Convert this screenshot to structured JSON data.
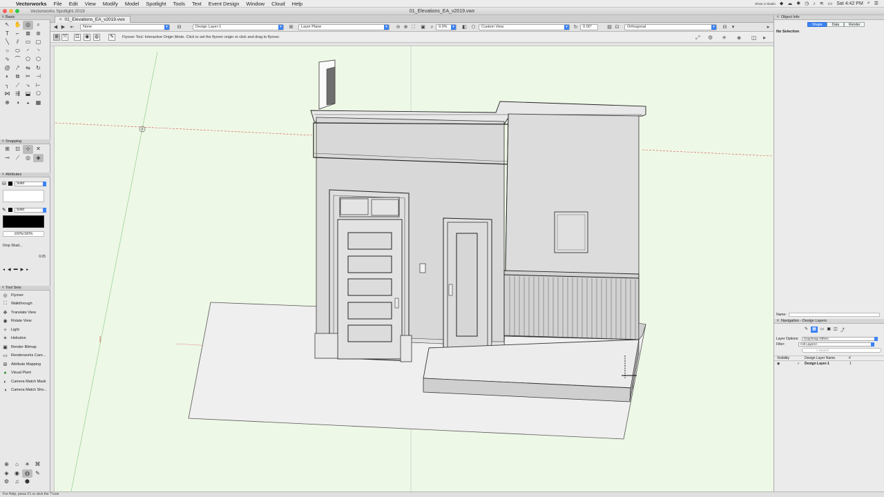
{
  "menubar": {
    "app_name": "Vectorworks",
    "items": [
      "File",
      "Edit",
      "View",
      "Modify",
      "Model",
      "Spotlight",
      "Tools",
      "Text",
      "Event Design",
      "Window",
      "Cloud",
      "Help"
    ],
    "clock": "Sat 4:42 PM",
    "indicator": "Show U Studio"
  },
  "window": {
    "app_title": "Vectorworks Spotlight 2019",
    "doc_title": "01_Elevations_EA_v2019.vwx",
    "tab_label": "01_Elevations_EA_v2019.vwx"
  },
  "viewbar": {
    "class_select": "None",
    "layer_select": "Design Layer-1",
    "plane_select": "Layer Plane",
    "zoom": "9.0%",
    "view_select": "Custom View",
    "rotation": "0.00°",
    "projection": "Orthogonal"
  },
  "modebar": {
    "help_text": "Flyover Tool: Interactive Origin Mode. Click to set the flyover origin or click and drag to flyover."
  },
  "palettes": {
    "basic_title": "Basic",
    "snapping_title": "Snapping",
    "attributes_title": "Attributes",
    "fill_style": "Solid",
    "pen_style": "Solid",
    "opacity": "100%/100%",
    "drop_shadow": "Drop Shad...",
    "line_weight": "0.05",
    "toolsets_title": "Tool Sets",
    "tool_sets": [
      {
        "icon": "flyover-icon",
        "label": "Flyover"
      },
      {
        "icon": "walkthrough-icon",
        "label": "Walkthrough"
      },
      {
        "icon": "translate-view-icon",
        "label": "Translate View"
      },
      {
        "icon": "rotate-view-icon",
        "label": "Rotate View"
      },
      {
        "icon": "light-icon",
        "label": "Light"
      },
      {
        "icon": "heliodon-icon",
        "label": "Heliodon"
      },
      {
        "icon": "renderer-bitmap-icon",
        "label": "Render Bitmap"
      },
      {
        "icon": "renderworks-camera-icon",
        "label": "Renderworks Cam..."
      },
      {
        "icon": "attribute-mapping-icon",
        "label": "Attribute Mapping"
      },
      {
        "icon": "visual-plant-icon",
        "label": "Visual Plant"
      },
      {
        "icon": "camera-match-mask-icon",
        "label": "Camera Match Mask"
      },
      {
        "icon": "camera-match-shot-icon",
        "label": "Camera Match Sho..."
      }
    ]
  },
  "object_info": {
    "title": "Object Info",
    "tabs": [
      "Shape",
      "Data",
      "Render"
    ],
    "active_tab": "Shape",
    "no_selection": "No Selection",
    "name_label": "Name:"
  },
  "navigation": {
    "title": "Navigation - Design Layers",
    "layer_options_label": "Layer Options:",
    "layer_options_value": "Gray/Snap Others",
    "filter_label": "Filter:",
    "filter_value": "<All Layers>",
    "search_placeholder": "Search",
    "columns": [
      "Visibility",
      "Design Layer Name",
      "#"
    ],
    "layers": [
      {
        "name": "Design Layer-1",
        "number": "1",
        "active": "✓"
      }
    ]
  },
  "statusbar": {
    "text": "For Help, press F1 or click the ? icon"
  },
  "colors": {
    "canvas_bg": "#eef8e6",
    "accent_blue": "#3b82f6",
    "model_gray": "#d9d9d9"
  }
}
